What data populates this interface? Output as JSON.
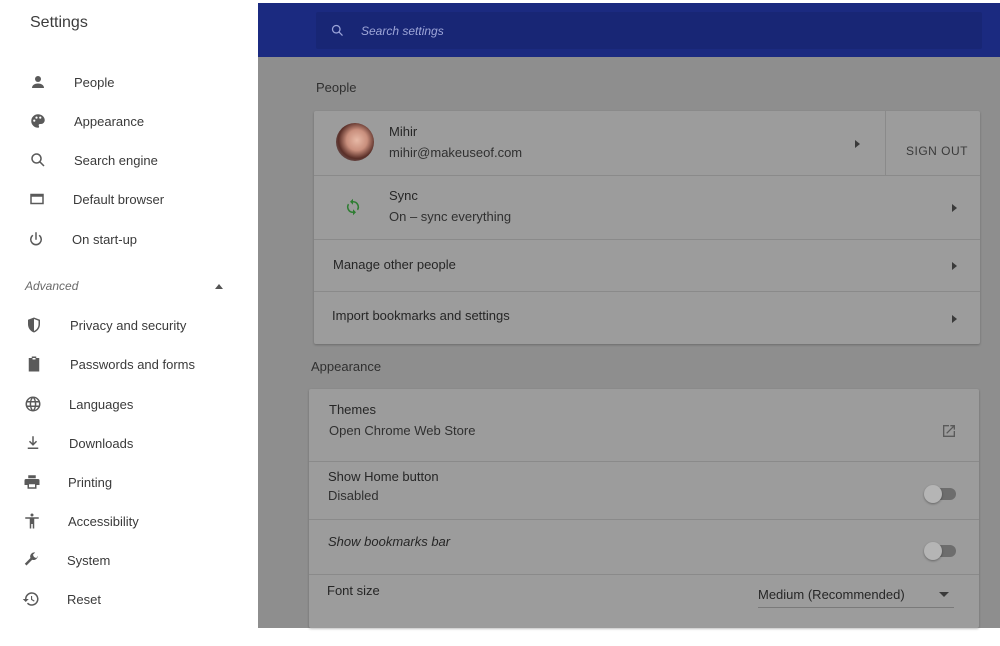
{
  "sidebar": {
    "title": "Settings",
    "items": [
      {
        "label": "People",
        "icon": "person-icon"
      },
      {
        "label": "Appearance",
        "icon": "palette-icon"
      },
      {
        "label": "Search engine",
        "icon": "search-icon"
      },
      {
        "label": "Default browser",
        "icon": "browser-icon"
      },
      {
        "label": "On start-up",
        "icon": "power-icon"
      }
    ],
    "advanced_label": "Advanced",
    "advanced_items": [
      {
        "label": "Privacy and security",
        "icon": "shield-icon"
      },
      {
        "label": "Passwords and forms",
        "icon": "clipboard-icon"
      },
      {
        "label": "Languages",
        "icon": "globe-icon"
      },
      {
        "label": "Downloads",
        "icon": "download-icon"
      },
      {
        "label": "Printing",
        "icon": "printer-icon"
      },
      {
        "label": "Accessibility",
        "icon": "accessibility-icon"
      },
      {
        "label": "System",
        "icon": "wrench-icon"
      },
      {
        "label": "Reset",
        "icon": "history-icon"
      }
    ]
  },
  "search": {
    "placeholder": "Search settings"
  },
  "people": {
    "title": "People",
    "account_name": "Mihir",
    "account_email": "mihir@makeuseof.com",
    "sign_out": "SIGN OUT",
    "sync_title": "Sync",
    "sync_status": "On – sync everything",
    "manage_label": "Manage other people",
    "import_label": "Import bookmarks and settings"
  },
  "appearance": {
    "title": "Appearance",
    "themes_label": "Themes",
    "themes_sub": "Open Chrome Web Store",
    "home_label": "Show Home button",
    "home_sub": "Disabled",
    "home_enabled": false,
    "bookmarks_label": "Show bookmarks bar",
    "bookmarks_enabled": false,
    "font_label": "Font size",
    "font_value": "Medium (Recommended)"
  },
  "colors": {
    "topbar": "#1b2a80",
    "sync_icon": "#2e7d32"
  }
}
